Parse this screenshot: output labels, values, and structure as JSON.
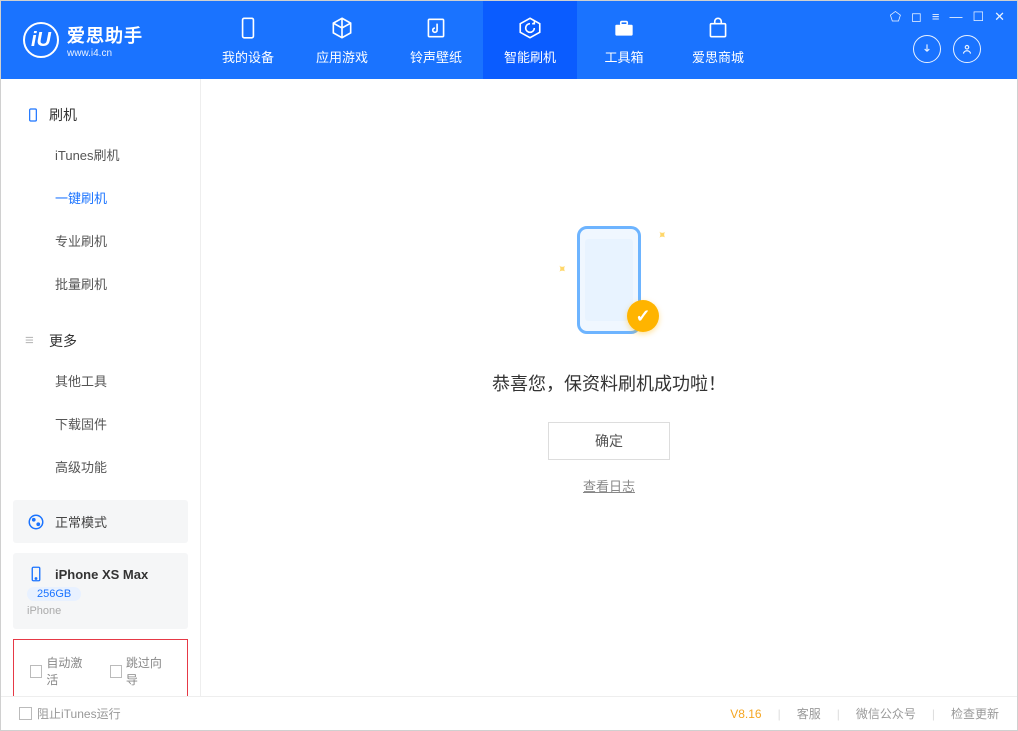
{
  "app": {
    "title": "爱思助手",
    "subtitle": "www.i4.cn",
    "logo_letter": "iU"
  },
  "nav": [
    {
      "label": "我的设备",
      "icon": "device"
    },
    {
      "label": "应用游戏",
      "icon": "cube"
    },
    {
      "label": "铃声壁纸",
      "icon": "music"
    },
    {
      "label": "智能刷机",
      "icon": "refresh",
      "active": true
    },
    {
      "label": "工具箱",
      "icon": "toolbox"
    },
    {
      "label": "爱思商城",
      "icon": "store"
    }
  ],
  "sidebar": {
    "section1": {
      "heading": "刷机",
      "items": [
        "iTunes刷机",
        "一键刷机",
        "专业刷机",
        "批量刷机"
      ],
      "active_index": 1
    },
    "section2": {
      "heading": "更多",
      "items": [
        "其他工具",
        "下载固件",
        "高级功能"
      ]
    }
  },
  "device": {
    "mode_label": "正常模式",
    "name": "iPhone XS Max",
    "storage": "256GB",
    "type": "iPhone"
  },
  "bottom_options": {
    "opt1": "自动激活",
    "opt2": "跳过向导"
  },
  "main": {
    "success_text": "恭喜您，保资料刷机成功啦！",
    "ok_button": "确定",
    "log_link": "查看日志"
  },
  "statusbar": {
    "block_itunes": "阻止iTunes运行",
    "version": "V8.16",
    "links": [
      "客服",
      "微信公众号",
      "检查更新"
    ]
  }
}
